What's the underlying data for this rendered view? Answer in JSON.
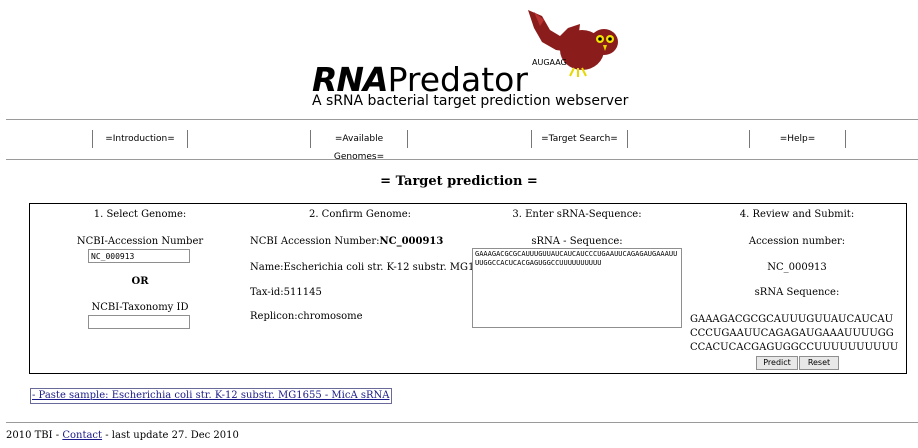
{
  "header": {
    "title_bold": "RNA",
    "title_rest": "Predator",
    "subtitle": "A sRNA bacterial target prediction webserver",
    "logo_sequence": "AUGAAG",
    "mascot_icon": "owl-mascot-icon"
  },
  "nav": [
    {
      "label": "=Introduction="
    },
    {
      "label": "=Available Genomes="
    },
    {
      "label": "=Target Search="
    },
    {
      "label": "=Help="
    }
  ],
  "page_heading": "= Target prediction =",
  "steps": {
    "select_genome": {
      "heading": "1. Select Genome:",
      "accession_label": "NCBI-Accession Number",
      "accession_value": "NC_000913",
      "or_label": "OR",
      "taxonomy_label": "NCBI-Taxonomy ID",
      "taxonomy_value": ""
    },
    "confirm_genome": {
      "heading": "2. Confirm Genome:",
      "accession_prefix": "NCBI Accession Number:",
      "accession_value": "NC_000913",
      "name": "Name:Escherichia coli str. K-12 substr. MG1655",
      "taxid": "Tax-id:511145",
      "replicon": "Replicon:chromosome"
    },
    "enter_srna": {
      "heading": "3. Enter sRNA-Sequence:",
      "label": "sRNA - Sequence:",
      "value": "GAAAGACGCGCAUUUGUUAUCAUCAUCCCUGAAUUCAGAGAUGAAAUUUUGGCCACUCACGAGUGGCCUUUUUUUUUU"
    },
    "review": {
      "heading": "4. Review and Submit:",
      "accession_label": "Accession number:",
      "accession_value": "NC_000913",
      "sequence_label": "sRNA Sequence:",
      "sequence_value": "GAAAGACGCGCAUUUGUUAUCAUCAUCCCUGAAUUCAGAGAUGAAAUUUUGGCCACUCACGAGUGGCCUUUUUUUUUU",
      "predict_label": "Predict",
      "reset_label": "Reset"
    }
  },
  "paste_sample": "- Paste sample: Escherichia coli str. K-12 substr. MG1655 - MicA sRNA",
  "footer": {
    "prefix": "2010 TBI -",
    "contact": "Contact",
    "suffix": "- last update 27. Dec 2010"
  },
  "colors": {
    "mascot_body": "#8b1c1c",
    "mascot_beak": "#e8d800",
    "link": "#1a1a8a"
  }
}
